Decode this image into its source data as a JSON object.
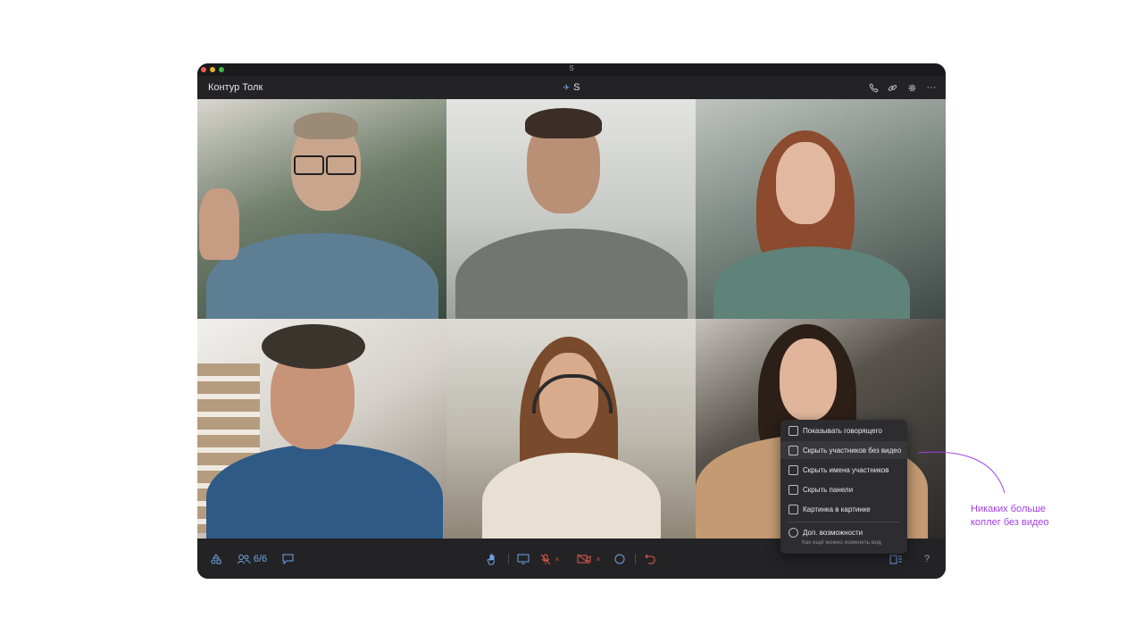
{
  "window": {
    "os_title": "S",
    "app_name": "Контур Толк",
    "meeting_name": "S"
  },
  "toolbar": {
    "participants_count": "6/6"
  },
  "view_menu": {
    "items": [
      {
        "label": "Показывать говорящего",
        "icon": "speaker-icon"
      },
      {
        "label": "Скрыть участников без видео",
        "icon": "hide-participants-icon"
      },
      {
        "label": "Скрыть имена участников",
        "icon": "hide-names-icon"
      },
      {
        "label": "Скрыть панели",
        "icon": "hide-panels-icon"
      },
      {
        "label": "Картинка в картинке",
        "icon": "picture-in-picture-icon"
      }
    ],
    "more": {
      "label": "Доп. возможности",
      "sublabel": "Как ещё можно изменить вид",
      "icon": "info-icon"
    }
  },
  "annotation": {
    "line1": "Никаких больше",
    "line2": "коллег без видео",
    "color": "#a040e6"
  },
  "colors": {
    "window_bg": "#232325",
    "mic_off": "#e05a4e",
    "accent": "#6ea3e8"
  }
}
